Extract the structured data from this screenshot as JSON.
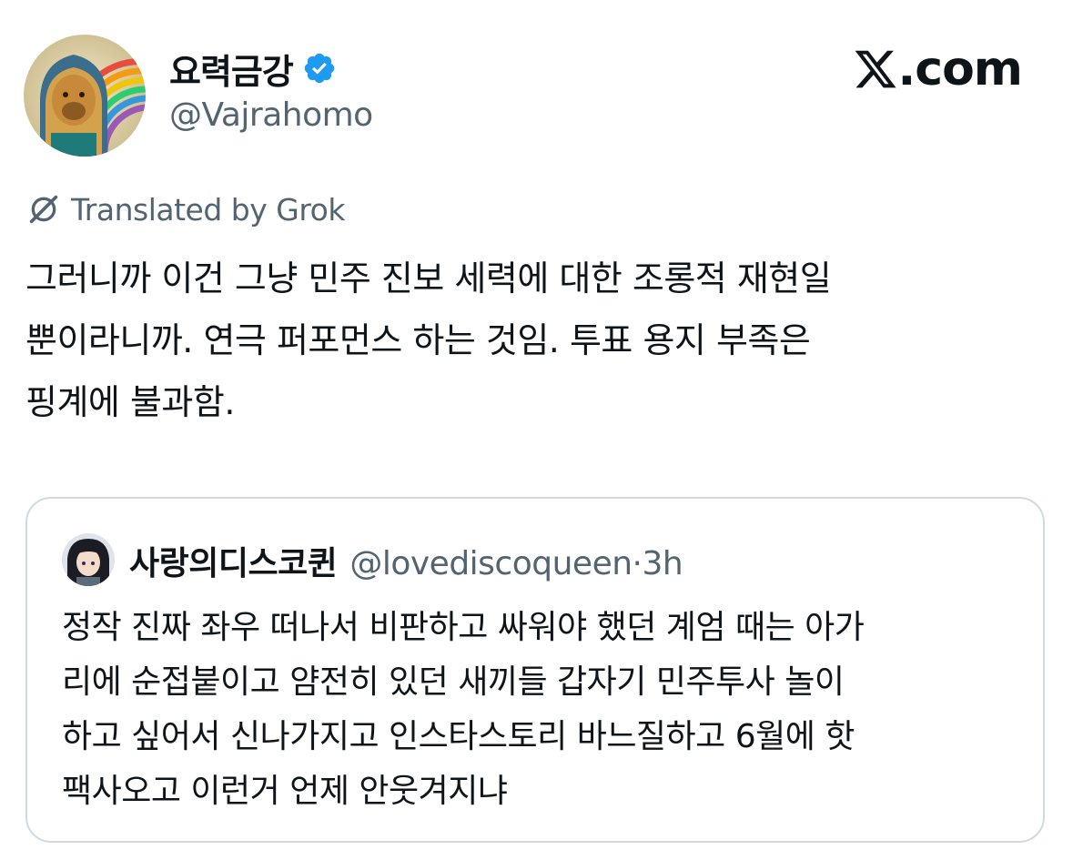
{
  "author": {
    "display_name": "요력금강",
    "handle": "@Vajrahomo",
    "verified": true,
    "avatar_icon": "lion-pharaoh-rainbow-avatar"
  },
  "brand": {
    "text": ".com",
    "logo_icon": "x-logo-icon"
  },
  "translation": {
    "label": "Translated by Grok",
    "icon": "grok-icon"
  },
  "tweet": {
    "text": "그러니까 이건 그냥 민주 진보 세력에 대한 조롱적 재현일\n뿐이라니까. 연극 퍼포먼스 하는 것임. 투표 용지 부족은\n핑계에 불과함."
  },
  "quoted_tweet": {
    "display_name": "사랑의디스코퀸",
    "handle": "@lovediscoqueen",
    "separator": "·",
    "time": "3h",
    "avatar_icon": "anime-girl-avatar",
    "text": "정작 진짜 좌우 떠나서 비판하고 싸워야 했던 계엄 때는 아가\n리에 순접붙이고 얌전히 있던 새끼들 갑자기 민주투사 놀이\n하고 싶어서 신나가지고 인스타스토리 바느질하고 6월에 핫\n팩사오고 이런거 언제 안웃겨지냐"
  },
  "colors": {
    "text_primary": "#0f1419",
    "text_secondary": "#536471",
    "verified_blue": "#1d9bf0",
    "border": "#cfd9de"
  }
}
